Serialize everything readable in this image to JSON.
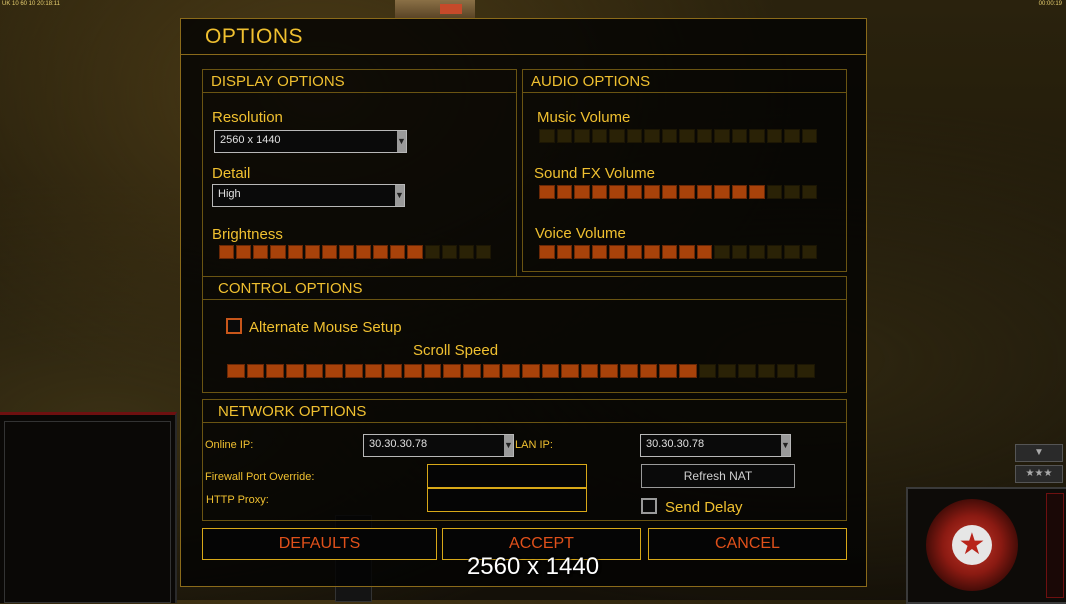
{
  "hud": {
    "top_left": "UK 10 60 10 20:18:11",
    "top_right": "00:00:19"
  },
  "dialog": {
    "title": "OPTIONS"
  },
  "display": {
    "header": "DISPLAY OPTIONS",
    "resolution_label": "Resolution",
    "resolution_value": "2560 x 1440",
    "detail_label": "Detail",
    "detail_value": "High",
    "brightness_label": "Brightness",
    "brightness_level": 0.75
  },
  "audio": {
    "header": "AUDIO OPTIONS",
    "music_label": "Music Volume",
    "music_level": 0.0,
    "sfx_label": "Sound FX Volume",
    "sfx_level": 0.8,
    "voice_label": "Voice Volume",
    "voice_level": 0.65
  },
  "control": {
    "header": "CONTROL OPTIONS",
    "alt_mouse_label": "Alternate Mouse Setup",
    "alt_mouse_checked": false,
    "scroll_label": "Scroll Speed",
    "scroll_level": 0.8
  },
  "network": {
    "header": "NETWORK OPTIONS",
    "online_ip_label": "Online IP:",
    "online_ip_value": "30.30.30.78",
    "lan_ip_label": "LAN IP:",
    "lan_ip_value": "30.30.30.78",
    "firewall_label": "Firewall Port Override:",
    "firewall_value": "",
    "proxy_label": "HTTP Proxy:",
    "proxy_value": "",
    "refresh_nat_label": "Refresh NAT",
    "send_delay_label": "Send Delay",
    "send_delay_checked": false
  },
  "buttons": {
    "defaults": "DEFAULTS",
    "accept": "ACCEPT",
    "cancel": "CANCEL"
  },
  "overlay_text": "2560 x 1440",
  "colors": {
    "accent": "#f0c030",
    "bar_on": "#a8420a",
    "bar_off": "#2a2206",
    "button_text": "#e0501a"
  }
}
